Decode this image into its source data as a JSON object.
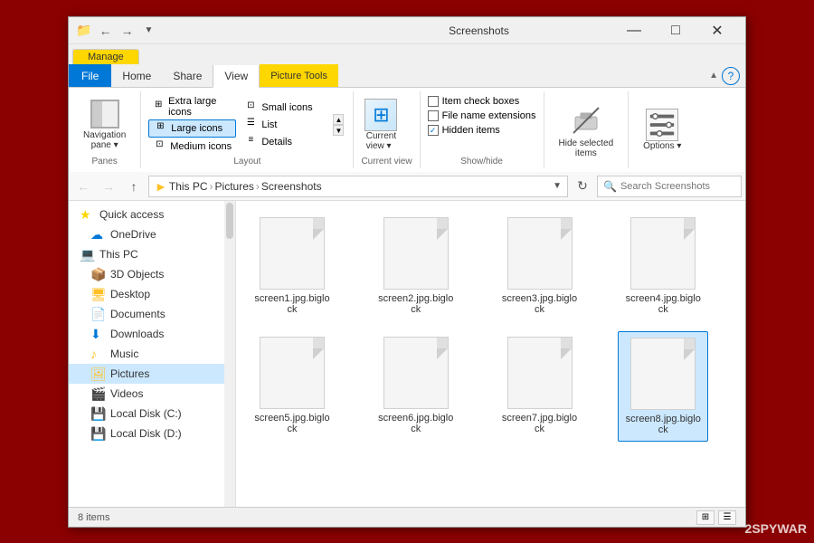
{
  "window": {
    "title": "Screenshots",
    "manage_tab": "Manage",
    "minimize": "—",
    "maximize": "□",
    "close": "✕"
  },
  "titlebar": {
    "quick_access_undo": "↩",
    "quick_access_redo": "↪",
    "dropdown": "▾"
  },
  "ribbon": {
    "tabs": [
      {
        "label": "File",
        "type": "file"
      },
      {
        "label": "Home",
        "type": "normal"
      },
      {
        "label": "Share",
        "type": "normal"
      },
      {
        "label": "View",
        "type": "active"
      },
      {
        "label": "Picture Tools",
        "type": "picture-tools"
      }
    ],
    "panes_group": {
      "label": "Panes",
      "nav_pane": "Navigation\npane"
    },
    "layout_group": {
      "label": "Layout",
      "items": [
        {
          "label": "Extra large icons",
          "active": false
        },
        {
          "label": "Large icons",
          "active": true
        },
        {
          "label": "Medium icons",
          "active": false
        },
        {
          "label": "Small icons",
          "active": false
        },
        {
          "label": "List",
          "active": false
        },
        {
          "label": "Details",
          "active": false
        }
      ]
    },
    "current_view": {
      "label": "Current\nview"
    },
    "showhide_group": {
      "label": "Show/hide",
      "items": [
        {
          "label": "Item check boxes",
          "checked": false
        },
        {
          "label": "File name extensions",
          "checked": false
        },
        {
          "label": "Hidden items",
          "checked": true
        }
      ]
    },
    "hide_selected": {
      "label": "Hide selected\nitems"
    },
    "options": {
      "label": "Options"
    }
  },
  "addressbar": {
    "back": "←",
    "forward": "→",
    "up": "↑",
    "path_parts": [
      "This PC",
      "Pictures",
      "Screenshots"
    ],
    "refresh": "⟳",
    "search_placeholder": "Search Screenshots"
  },
  "sidebar": {
    "items": [
      {
        "label": "Quick access",
        "icon": "star",
        "indent": 0
      },
      {
        "label": "OneDrive",
        "icon": "cloud",
        "indent": 1
      },
      {
        "label": "This PC",
        "icon": "pc",
        "indent": 0
      },
      {
        "label": "3D Objects",
        "icon": "folder3d",
        "indent": 1
      },
      {
        "label": "Desktop",
        "icon": "desktop",
        "indent": 1
      },
      {
        "label": "Documents",
        "icon": "docs",
        "indent": 1
      },
      {
        "label": "Downloads",
        "icon": "downloads",
        "indent": 1
      },
      {
        "label": "Music",
        "icon": "music",
        "indent": 1
      },
      {
        "label": "Pictures",
        "icon": "pictures",
        "indent": 1,
        "active": true
      },
      {
        "label": "Videos",
        "icon": "videos",
        "indent": 1
      },
      {
        "label": "Local Disk (C:)",
        "icon": "disk",
        "indent": 1
      },
      {
        "label": "Local Disk (D:)",
        "icon": "disk",
        "indent": 1
      }
    ]
  },
  "files": [
    {
      "name": "screen1.jpg.biglock",
      "selected": false
    },
    {
      "name": "screen2.jpg.biglock",
      "selected": false
    },
    {
      "name": "screen3.jpg.biglock",
      "selected": false
    },
    {
      "name": "screen4.jpg.biglock",
      "selected": false
    },
    {
      "name": "screen5.jpg.biglock",
      "selected": false
    },
    {
      "name": "screen6.jpg.biglock",
      "selected": false
    },
    {
      "name": "screen7.jpg.biglock",
      "selected": false
    },
    {
      "name": "screen8.jpg.biglock",
      "selected": true
    }
  ],
  "statusbar": {
    "count": "8 items",
    "watermark": "2SPYWAR"
  }
}
